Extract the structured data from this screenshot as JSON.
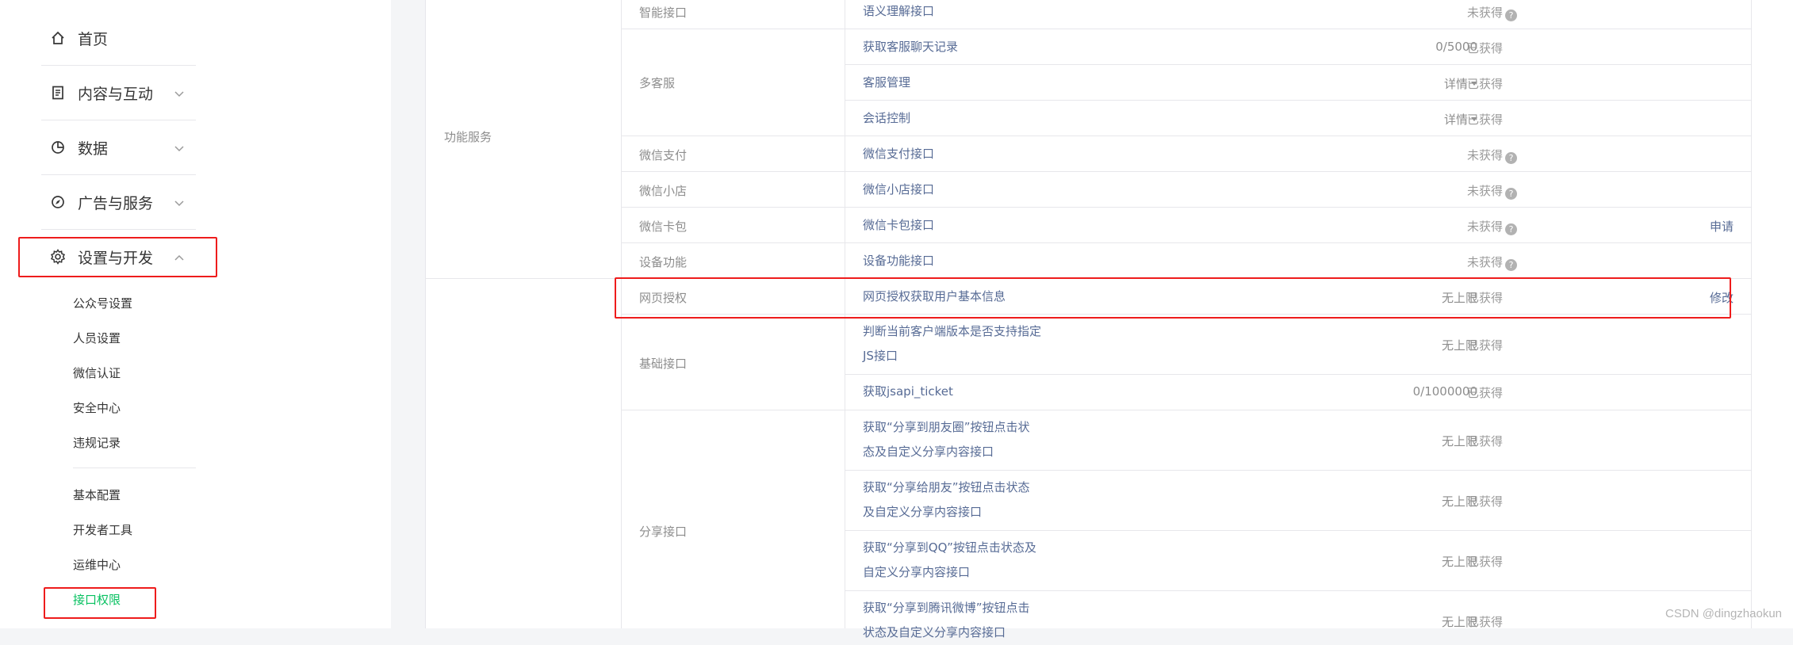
{
  "sidebar": {
    "nav": [
      {
        "label": "首页",
        "icon": "home-icon",
        "expandable": false
      },
      {
        "label": "内容与互动",
        "icon": "document-icon",
        "expandable": true
      },
      {
        "label": "数据",
        "icon": "chart-icon",
        "expandable": true
      },
      {
        "label": "广告与服务",
        "icon": "compass-icon",
        "expandable": true
      },
      {
        "label": "设置与开发",
        "icon": "gear-icon",
        "expandable": true,
        "expanded": true
      }
    ],
    "sub_group_1": [
      "公众号设置",
      "人员设置",
      "微信认证",
      "安全中心",
      "违规记录"
    ],
    "sub_group_2": [
      "基本配置",
      "开发者工具",
      "运维中心",
      "接口权限"
    ],
    "active_item": "接口权限",
    "active_color": "#07c160"
  },
  "table": {
    "groups": [
      "功能服务"
    ],
    "rows": [
      {
        "category": "智能接口",
        "interface": "语义理解接口",
        "quota": "",
        "status": "未获得",
        "help": true,
        "op": ""
      },
      {
        "category": "多客服",
        "interface": "获取客服聊天记录",
        "quota": "0/5000",
        "status": "已获得",
        "help": false,
        "op": ""
      },
      {
        "category": "",
        "interface": "客服管理",
        "quota": "详情",
        "status": "已获得",
        "help": false,
        "op": ""
      },
      {
        "category": "",
        "interface": "会话控制",
        "quota": "详情",
        "status": "已获得",
        "help": false,
        "op": ""
      },
      {
        "category": "微信支付",
        "interface": "微信支付接口",
        "quota": "",
        "status": "未获得",
        "help": true,
        "op": ""
      },
      {
        "category": "微信小店",
        "interface": "微信小店接口",
        "quota": "",
        "status": "未获得",
        "help": true,
        "op": ""
      },
      {
        "category": "微信卡包",
        "interface": "微信卡包接口",
        "quota": "",
        "status": "未获得",
        "help": true,
        "op": "申请"
      },
      {
        "category": "设备功能",
        "interface": "设备功能接口",
        "quota": "",
        "status": "未获得",
        "help": true,
        "op": ""
      },
      {
        "category": "网页授权",
        "interface": "网页授权获取用户基本信息",
        "quota": "无上限",
        "status": "已获得",
        "help": false,
        "op": "修改"
      },
      {
        "category": "基础接口",
        "interface": "判断当前客户端版本是否支持指定JS接口",
        "quota": "无上限",
        "status": "已获得",
        "help": false,
        "op": ""
      },
      {
        "category": "",
        "interface": "获取jsapi_ticket",
        "quota": "0/1000000",
        "status": "已获得",
        "help": false,
        "op": ""
      },
      {
        "category": "分享接口",
        "interface": "获取“分享到朋友圈”按钮点击状态及自定义分享内容接口",
        "quota": "无上限",
        "status": "已获得",
        "help": false,
        "op": ""
      },
      {
        "category": "",
        "interface": "获取“分享给朋友”按钮点击状态及自定义分享内容接口",
        "quota": "无上限",
        "status": "已获得",
        "help": false,
        "op": ""
      },
      {
        "category": "",
        "interface": "获取“分享到QQ”按钮点击状态及自定义分享内容接口",
        "quota": "无上限",
        "status": "已获得",
        "help": false,
        "op": ""
      },
      {
        "category": "",
        "interface": "获取“分享到腾讯微博”按钮点击状态及自定义分享内容接口",
        "quota": "无上限",
        "status": "已获得",
        "help": false,
        "op": ""
      }
    ],
    "help_glyph": "?"
  },
  "watermark": "CSDN @dingzhaokun",
  "colors": {
    "highlight": "#ee1c1c",
    "link": "#576b95"
  }
}
